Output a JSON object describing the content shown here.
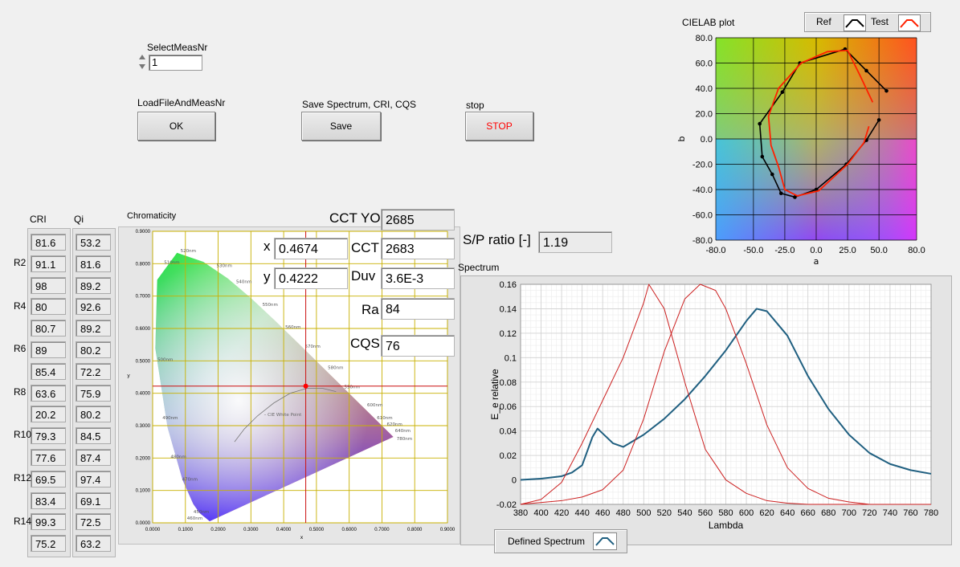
{
  "controls": {
    "select_meas_label": "SelectMeasNr",
    "select_meas_value": "1",
    "load_label": "LoadFileAndMeasNr",
    "ok_label": "OK",
    "save_label_caption": "Save Spectrum, CRI, CQS",
    "save_label": "Save",
    "stop_caption": "stop",
    "stop_label": "STOP"
  },
  "colors": {
    "stop_text": "#ff0000",
    "ref": "#000000",
    "test": "#ff2000",
    "spectrum": "#1f5f80",
    "curve": "#cc2020",
    "grid": "#c8b000"
  },
  "cri": {
    "header": "CRI",
    "row_labels": [
      "R2",
      "R4",
      "R6",
      "R8",
      "R10",
      "R12",
      "R14"
    ],
    "values": [
      "81.6",
      "91.1",
      "98",
      "80",
      "80.7",
      "89",
      "85.4",
      "63.6",
      "20.2",
      "79.3",
      "77.6",
      "69.5",
      "83.4",
      "99.3",
      "75.2"
    ]
  },
  "qi": {
    "header": "Qi",
    "values": [
      "53.2",
      "81.6",
      "89.2",
      "92.6",
      "89.2",
      "80.2",
      "72.2",
      "75.9",
      "80.2",
      "84.5",
      "87.4",
      "97.4",
      "69.1",
      "72.5",
      "63.2"
    ]
  },
  "chromaticity": {
    "title": "Chromaticity",
    "x_label": "x",
    "x_value": "0.4674",
    "y_label": "y",
    "y_value": "0.4222",
    "xaxis_label": "x",
    "yaxis_label": "y",
    "x_ticks": [
      "0.0000",
      "0.1000",
      "0.2000",
      "0.3000",
      "0.4000",
      "0.5000",
      "0.6000",
      "0.7000",
      "0.8000",
      "0.9000"
    ],
    "y_ticks": [
      "0.9000",
      "0.8000",
      "0.7000",
      "0.6000",
      "0.5000",
      "0.4000",
      "0.3000",
      "0.2000",
      "0.1000",
      "0.0000"
    ],
    "white_point_label": "CIE White Point",
    "locus_labels": [
      "470nm",
      "480nm",
      "490nm",
      "500nm",
      "510nm",
      "520nm",
      "530nm",
      "540nm",
      "550nm",
      "560nm",
      "570nm",
      "580nm",
      "590nm",
      "600nm",
      "610nm",
      "620nm",
      "640nm",
      "780nm",
      "460nm",
      "450nm"
    ],
    "cursor": {
      "x": 0.4674,
      "y": 0.4222
    }
  },
  "results": {
    "cct_yo_label": "CCT YO",
    "cct_yo_value": "2685",
    "cct_label": "CCT",
    "cct_value": "2683",
    "duv_label": "Duv",
    "duv_value": "3.6E-3",
    "ra_label": "Ra",
    "ra_value": "84",
    "cqs_label": "CQS",
    "cqs_value": "76",
    "sp_label": "S/P ratio [-]",
    "sp_value": "1.19"
  },
  "cielab": {
    "title": "CIELAB plot",
    "legend_ref": "Ref",
    "legend_test": "Test",
    "xlabel": "a",
    "ylabel": "b",
    "x_ticks": [
      "-80.0",
      "-50.0",
      "-25.0",
      "0.0",
      "25.0",
      "50.0",
      "80.0"
    ],
    "y_ticks": [
      "80.0",
      "60.0",
      "40.0",
      "20.0",
      "0.0",
      "-20.0",
      "-40.0",
      "-60.0",
      "-80.0"
    ]
  },
  "chart_data": {
    "type": "line",
    "title": "Spectrum",
    "xlabel": "Lambda",
    "ylabel": "E_e relative",
    "xlim": [
      380,
      780
    ],
    "ylim": [
      -0.02,
      0.16
    ],
    "x_ticks": [
      "380",
      "400",
      "420",
      "440",
      "460",
      "480",
      "500",
      "520",
      "540",
      "560",
      "580",
      "600",
      "620",
      "640",
      "660",
      "680",
      "700",
      "720",
      "740",
      "760",
      "780"
    ],
    "y_ticks": [
      "0.16",
      "0.14",
      "0.12",
      "0.1",
      "0.08",
      "0.06",
      "0.04",
      "0.02",
      "0",
      "-0.02"
    ],
    "legend": "Defined Spectrum",
    "series": [
      {
        "name": "Defined Spectrum",
        "x": [
          380,
          400,
          420,
          430,
          440,
          450,
          455,
          460,
          470,
          480,
          500,
          520,
          540,
          560,
          580,
          600,
          610,
          620,
          640,
          660,
          680,
          700,
          720,
          740,
          760,
          780
        ],
        "y": [
          0.0,
          0.001,
          0.003,
          0.006,
          0.012,
          0.035,
          0.042,
          0.038,
          0.03,
          0.027,
          0.037,
          0.05,
          0.066,
          0.085,
          0.106,
          0.13,
          0.14,
          0.138,
          0.118,
          0.085,
          0.058,
          0.037,
          0.022,
          0.013,
          0.008,
          0.005
        ]
      },
      {
        "x": [
          380,
          400,
          420,
          440,
          460,
          480,
          500,
          505,
          520,
          540,
          560,
          580,
          600,
          620,
          640,
          660,
          680,
          700,
          740,
          780
        ],
        "y": [
          -0.02,
          -0.016,
          -0.002,
          0.03,
          0.065,
          0.1,
          0.145,
          0.16,
          0.14,
          0.08,
          0.025,
          0.0,
          -0.011,
          -0.017,
          -0.019,
          -0.02,
          -0.02,
          -0.02,
          -0.02,
          -0.02
        ]
      },
      {
        "x": [
          380,
          420,
          440,
          460,
          480,
          500,
          520,
          540,
          555,
          570,
          580,
          600,
          620,
          640,
          660,
          680,
          700,
          720,
          740,
          780
        ],
        "y": [
          -0.02,
          -0.017,
          -0.014,
          -0.008,
          0.008,
          0.05,
          0.105,
          0.148,
          0.16,
          0.155,
          0.14,
          0.095,
          0.045,
          0.01,
          -0.007,
          -0.015,
          -0.018,
          -0.02,
          -0.02,
          -0.02
        ]
      }
    ]
  }
}
